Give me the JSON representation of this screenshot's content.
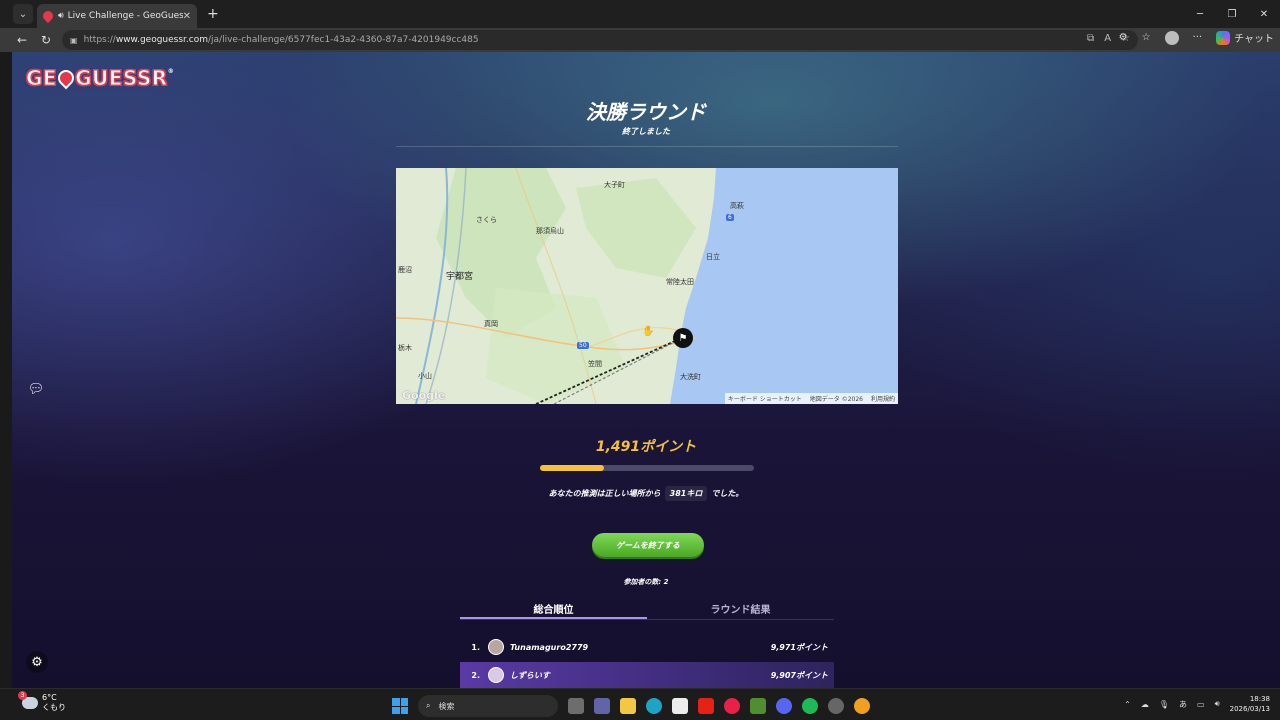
{
  "browser": {
    "tab_title": "Live Challenge - GeoGuessr",
    "url_prefix": "https://",
    "url_host": "www.geoguessr.com",
    "url_path": "/ja/live-challenge/6577fec1-43a2-4360-87a7-4201949cc485",
    "copilot_label": "チャット"
  },
  "game": {
    "logo_text_left": "GE",
    "logo_text_right": "GUESSR",
    "round_title": "決勝ラウンド",
    "round_status": "終了しました",
    "points_label": "1,491ポイント",
    "score_fraction": 0.3,
    "distance_before": "あなたの推測は正しい場所から",
    "distance_value": "381キロ",
    "distance_after": "でした。",
    "end_button": "ゲームを終了する",
    "participants": "参加者の数: 2",
    "tab_overall": "総合順位",
    "tab_round": "ラウンド結果",
    "leaderboard": [
      {
        "rank": "1.",
        "name": "Tunamaguro2779",
        "score": "9,971ポイント"
      },
      {
        "rank": "2.",
        "name": "しずらいす",
        "score": "9,907ポイント"
      }
    ]
  },
  "map": {
    "labels": [
      "大子町",
      "高萩",
      "さくら",
      "那須烏山",
      "日立",
      "鹿沼",
      "宇都宮",
      "常陸太田",
      "真岡",
      "笠間",
      "大洗町",
      "小山",
      "栃木"
    ],
    "route_labels": [
      "50",
      "6"
    ],
    "google": "Google",
    "attrib_keys": "キーボード ショートカット",
    "attrib_data": "地図データ ©2026",
    "attrib_terms": "利用規約"
  },
  "taskbar": {
    "temp": "6°C",
    "weather": "くもり",
    "weather_badge": "3",
    "search": "検索",
    "ime": "あ",
    "time": "18:38",
    "date": "2026/03/13"
  }
}
